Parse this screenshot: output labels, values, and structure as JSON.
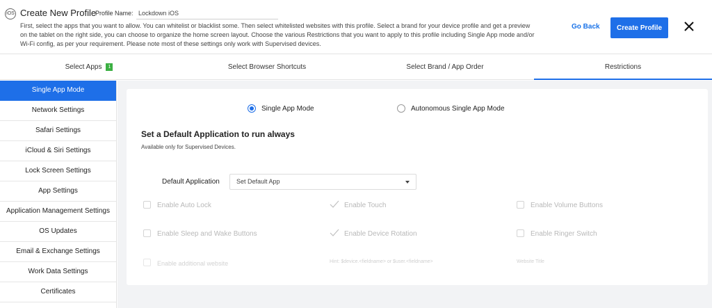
{
  "header": {
    "ios_badge": "iOS",
    "title": "Create New Profile",
    "profile_name_label": "Profile Name:",
    "profile_name_value": "Lockdown iOS",
    "description": "First, select the apps that you want to allow. You can whitelist or blacklist some. Then select whitelisted websites with this profile. Select a brand for your device profile and get a preview on the tablet on the right side, you can choose to organize the home screen layout. Choose the various Restrictions that you want to apply to this profile including Single App mode and/or Wi-Fi config, as per your requirement. Please note most of these settings only work with Supervised devices.",
    "go_back_label": "Go Back",
    "create_label": "Create Profile"
  },
  "tabs": [
    {
      "label": "Select Apps",
      "count": "1"
    },
    {
      "label": "Select Browser Shortcuts"
    },
    {
      "label": "Select Brand / App Order"
    },
    {
      "label": "Restrictions",
      "active": true
    }
  ],
  "sidebar": {
    "items": [
      {
        "label": "Single App Mode",
        "active": true
      },
      {
        "label": "Network Settings"
      },
      {
        "label": "Safari Settings"
      },
      {
        "label": "iCloud & Siri Settings"
      },
      {
        "label": "Lock Screen Settings"
      },
      {
        "label": "App Settings"
      },
      {
        "label": "Application Management Settings"
      },
      {
        "label": "OS Updates"
      },
      {
        "label": "Email & Exchange Settings"
      },
      {
        "label": "Work Data Settings"
      },
      {
        "label": "Certificates"
      }
    ]
  },
  "main": {
    "mode_options": [
      {
        "label": "Single App Mode",
        "selected": true
      },
      {
        "label": "Autonomous Single App Mode",
        "selected": false
      }
    ],
    "section_title": "Set a Default Application to run always",
    "section_subtitle": "Available only for Supervised Devices.",
    "default_app_label": "Default Application",
    "default_app_value": "Set Default App",
    "options": [
      {
        "label": "Enable Auto Lock",
        "checked": false
      },
      {
        "label": "Enable Touch",
        "checked": true
      },
      {
        "label": "Enable Volume Buttons",
        "checked": false
      },
      {
        "label": "Enable Sleep and Wake Buttons",
        "checked": false
      },
      {
        "label": "Enable Device Rotation",
        "checked": true
      },
      {
        "label": "Enable Ringer Switch",
        "checked": false
      },
      {
        "label": "Enable additional website",
        "checked": false
      }
    ],
    "website_hint": "Hint: $device.<fieldname> or $user.<fieldname>",
    "website_title_placeholder": "Website Title"
  },
  "colors": {
    "accent": "#1e6fe8",
    "badge_green": "#3cb043",
    "content_bg": "#f2f3f5"
  }
}
